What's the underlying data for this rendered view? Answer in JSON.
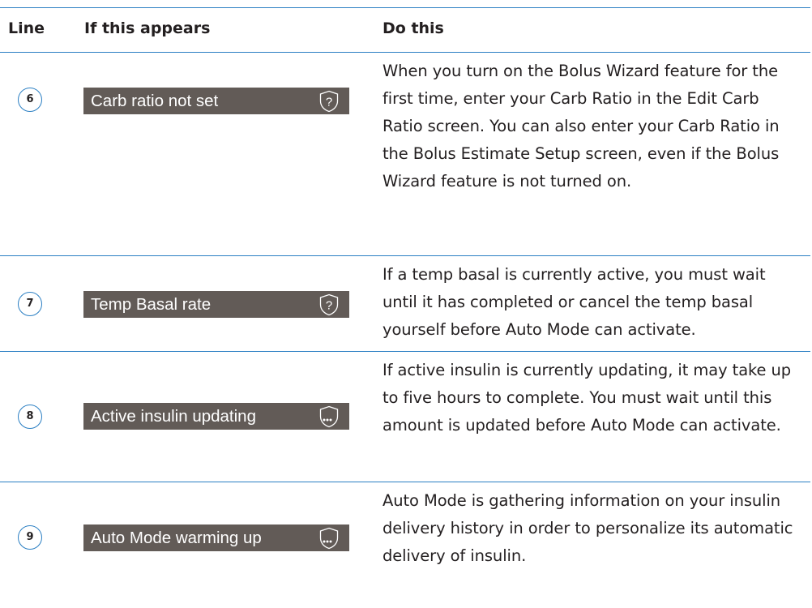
{
  "header": {
    "line": "Line",
    "appears": "If this appears",
    "do": "Do this"
  },
  "rows": [
    {
      "line": "6",
      "screen_text": "Carb ratio not set",
      "icon": "help-shield-icon",
      "description": "When you turn on the Bolus Wizard feature for the first time, enter your Carb Ratio in the Edit Carb Ratio screen. You can also enter your Carb Ratio in the Bolus Estimate Setup screen, even if the Bolus Wizard feature is not turned on."
    },
    {
      "line": "7",
      "screen_text": "Temp Basal rate",
      "icon": "help-shield-icon",
      "description": "If a temp basal is currently active, you must wait until it has completed or cancel the temp basal yourself before Auto Mode can activate."
    },
    {
      "line": "8",
      "screen_text": "Active insulin updating",
      "icon": "waiting-shield-icon",
      "description": "If active insulin is currently updating, it may take up to five hours to complete. You must wait until this amount is updated before Auto Mode can activate."
    },
    {
      "line": "9",
      "screen_text": "Auto Mode warming up",
      "icon": "waiting-shield-icon",
      "description": "Auto Mode is gathering information on your insulin delivery history in order to personalize its automatic delivery of insulin."
    }
  ],
  "colors": {
    "rule": "#2b7fc3",
    "screen_bg": "#625b57",
    "screen_text": "#ffffff",
    "body_text": "#231f20"
  }
}
